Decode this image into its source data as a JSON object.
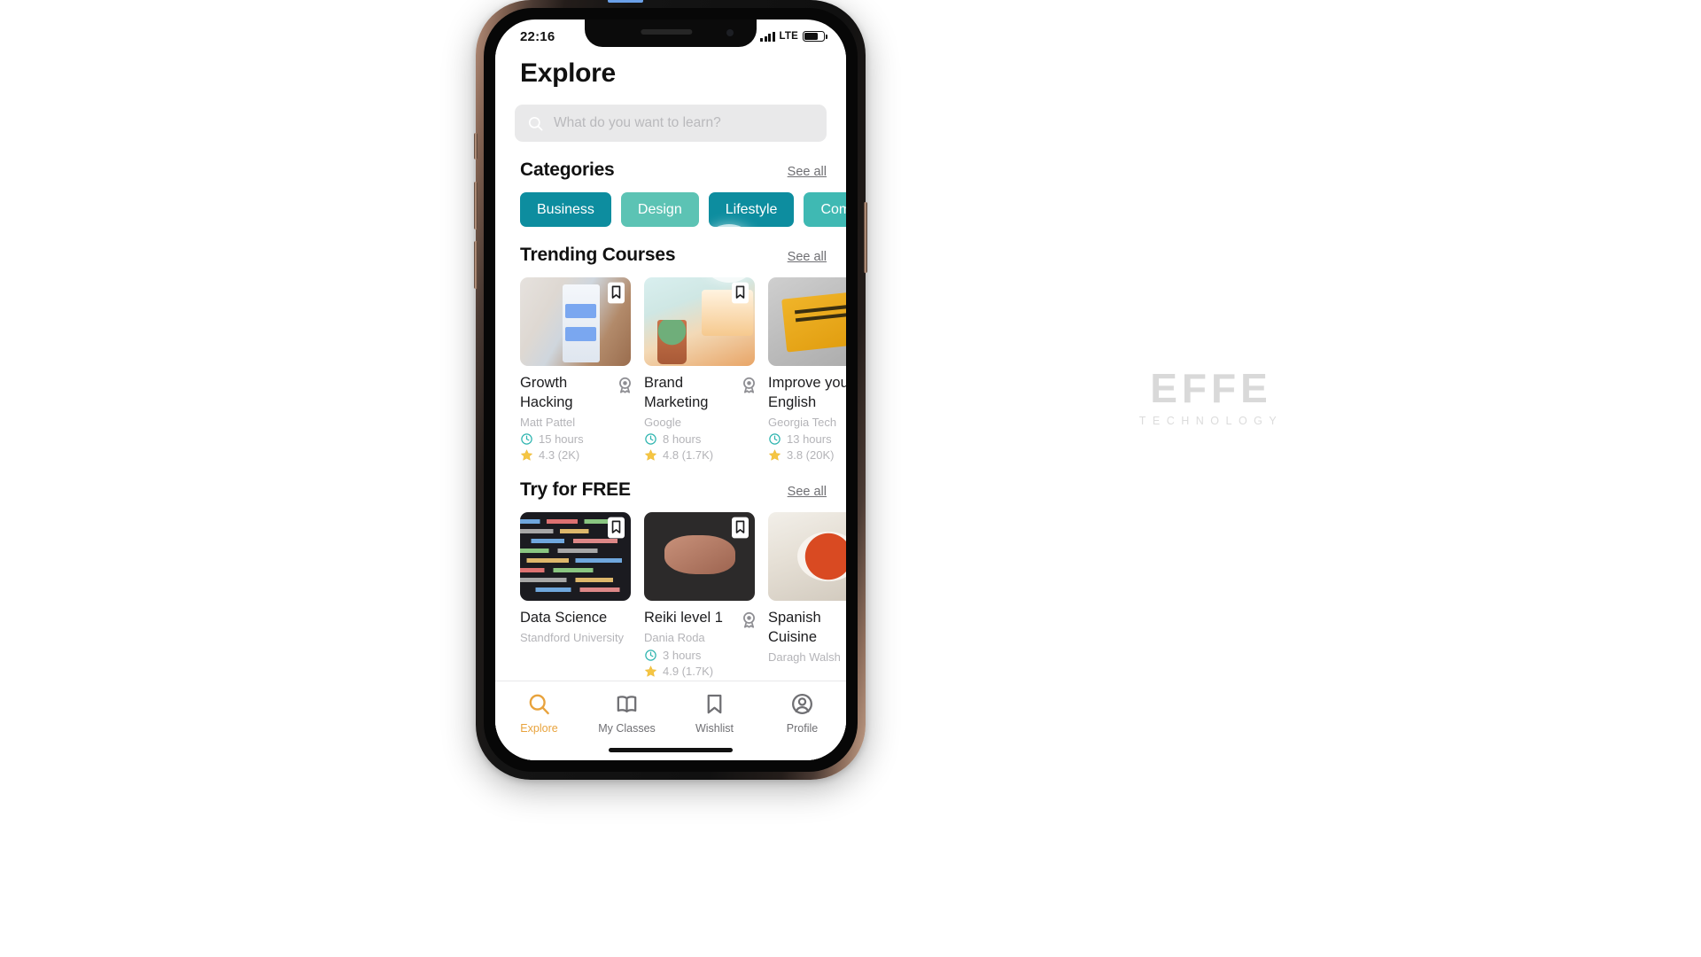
{
  "watermark": {
    "main": "EFFE",
    "sub": "TECHNOLOGY"
  },
  "status_bar": {
    "time": "22:16",
    "network": "LTE",
    "signal_icon": "signal-bars-icon",
    "battery_icon": "battery-icon",
    "battery_level": 72
  },
  "header": {
    "title": "Explore"
  },
  "search": {
    "placeholder": "What do you want to learn?",
    "value": "",
    "icon": "search-icon"
  },
  "categories": {
    "title": "Categories",
    "see_all": "See all",
    "chips": [
      {
        "label": "Business",
        "color": "#0d8d9f"
      },
      {
        "label": "Design",
        "color": "#5cc3b4"
      },
      {
        "label": "Lifestyle",
        "color": "#0d8d9f"
      },
      {
        "label": "Computer",
        "color": "#3fb9b3"
      }
    ]
  },
  "trending": {
    "title": "Trending Courses",
    "see_all": "See all",
    "courses": [
      {
        "title": "Growth Hacking",
        "author": "Matt Pattel",
        "duration": "15 hours",
        "rating": "4.3 (2K)",
        "art": "art-phone",
        "certified": true,
        "bookmark_icon": "bookmark-icon",
        "clock_icon": "clock-icon",
        "star_icon": "star-icon",
        "badge_icon": "certificate-badge-icon"
      },
      {
        "title": "Brand Marketing",
        "author": "Google",
        "duration": "8 hours",
        "rating": "4.8 (1.7K)",
        "art": "art-desk",
        "certified": true,
        "bookmark_icon": "bookmark-icon",
        "clock_icon": "clock-icon",
        "star_icon": "star-icon",
        "badge_icon": "certificate-badge-icon"
      },
      {
        "title": "Improve your English",
        "author": "Georgia Tech",
        "duration": "13 hours",
        "rating": "3.8 (20K)",
        "art": "art-book",
        "certified": true,
        "bookmark_icon": "bookmark-icon",
        "clock_icon": "clock-icon",
        "star_icon": "star-icon",
        "badge_icon": "certificate-badge-icon"
      }
    ]
  },
  "free": {
    "title": "Try for FREE",
    "see_all": "See all",
    "courses": [
      {
        "title": "Data Science",
        "author": "Standford University",
        "duration": "",
        "rating": "",
        "art": "art-code",
        "certified": false,
        "bookmark_icon": "bookmark-icon",
        "clock_icon": "clock-icon",
        "star_icon": "star-icon",
        "badge_icon": "certificate-badge-icon"
      },
      {
        "title": "Reiki level 1",
        "author": "Dania Roda",
        "duration": "3 hours",
        "rating": "4.9 (1.7K)",
        "art": "art-hands",
        "certified": true,
        "bookmark_icon": "bookmark-icon",
        "clock_icon": "clock-icon",
        "star_icon": "star-icon",
        "badge_icon": "certificate-badge-icon"
      },
      {
        "title": "Spanish Cuisine",
        "author": "Daragh Walsh",
        "duration": "",
        "rating": "",
        "art": "art-food",
        "certified": false,
        "bookmark_icon": "bookmark-icon",
        "clock_icon": "clock-icon",
        "star_icon": "star-icon",
        "badge_icon": "certificate-badge-icon"
      }
    ]
  },
  "tabbar": {
    "active": "Explore",
    "items": [
      {
        "label": "Explore",
        "icon": "search-icon",
        "active": true
      },
      {
        "label": "My Classes",
        "icon": "book-icon",
        "active": false
      },
      {
        "label": "Wishlist",
        "icon": "bookmark-icon",
        "active": false
      },
      {
        "label": "Profile",
        "icon": "person-icon",
        "active": false
      }
    ]
  },
  "colors": {
    "accent": "#e8a33d",
    "teal_dark": "#0d8d9f",
    "teal_light": "#5cc3b4",
    "muted_text": "#b4b4b8",
    "star": "#f5c542"
  }
}
